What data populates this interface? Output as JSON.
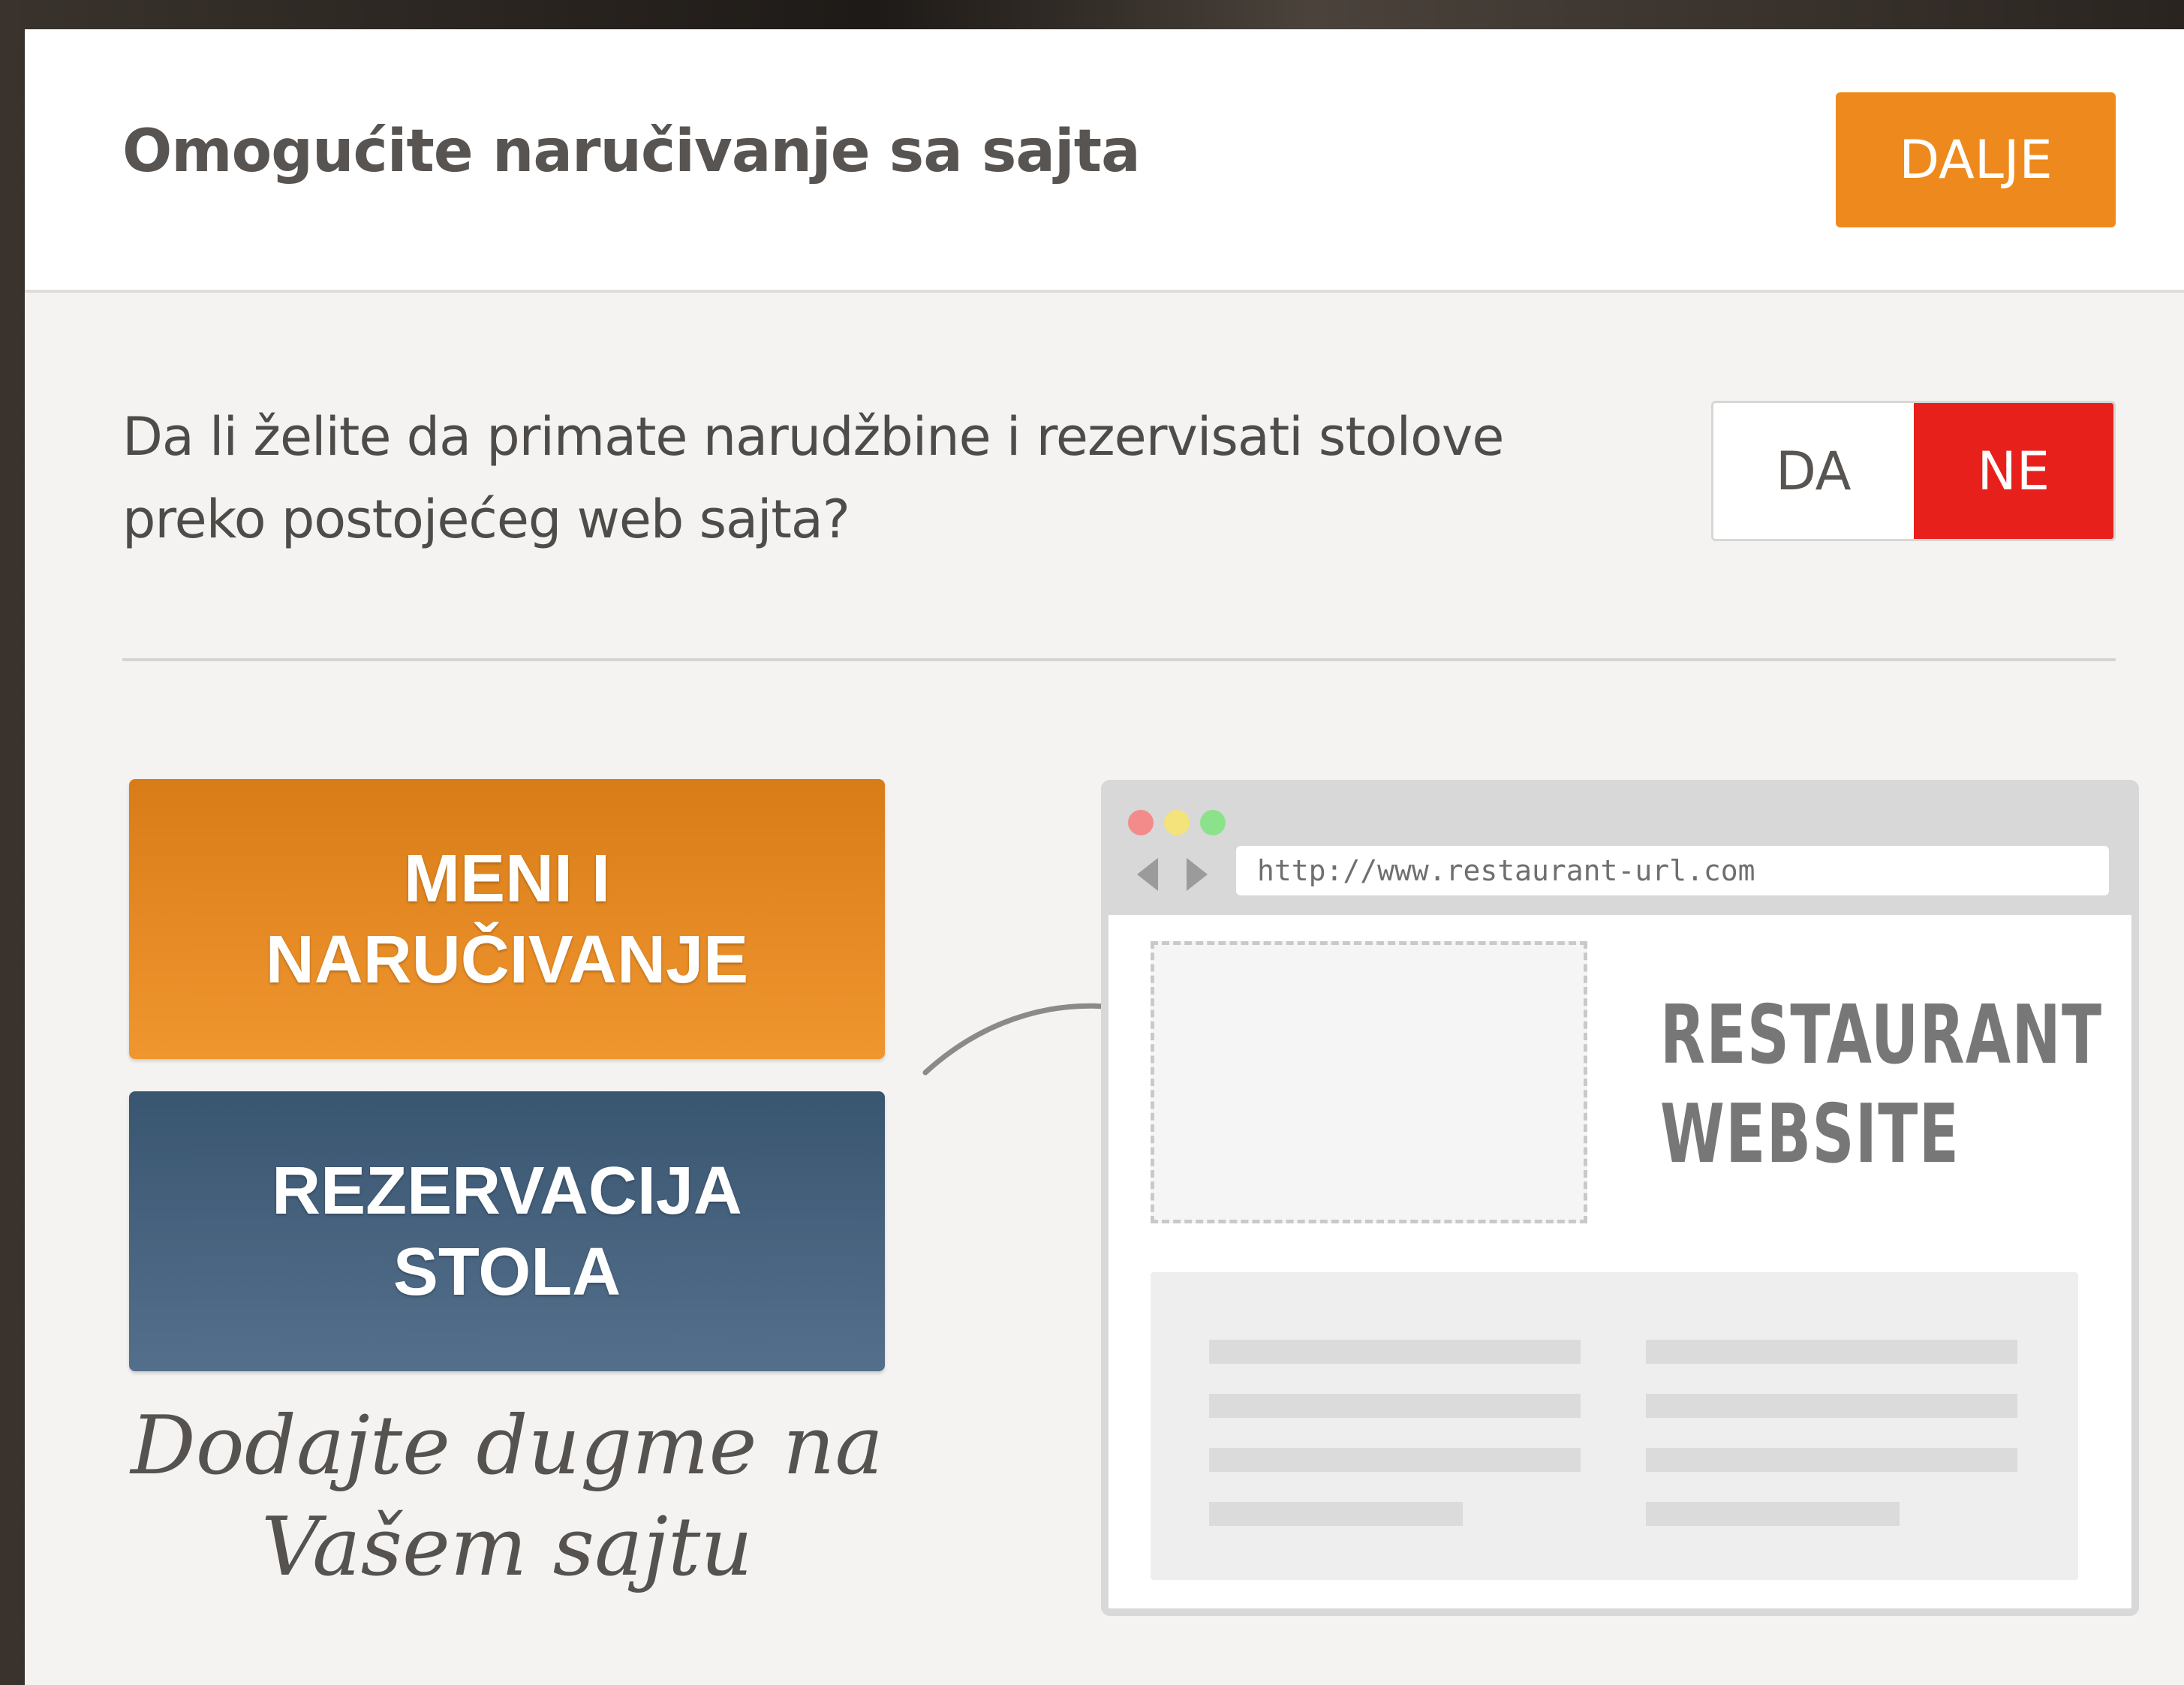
{
  "modal": {
    "title": "Omogućite naručivanje sa sajta",
    "next_button": "DALJE"
  },
  "question": {
    "text": "Da li želite da primate narudžbine i rezervisati stolove preko postojećeg web sajta?"
  },
  "toggle": {
    "yes_label": "DA",
    "no_label": "NE",
    "selected": "NE"
  },
  "illustration": {
    "order_button": "MENI I NARUČIVANJE",
    "reserve_button": "REZERVACIJA STOLA",
    "caption": "Dodajte dugme na Vašem sajtu",
    "browser_url": "http://www.restaurant-url.com",
    "site_title": "RESTAURANT\nWEBSITE"
  },
  "colors": {
    "accent_orange": "#ee8a1d",
    "no_red": "#e8201c",
    "reserve_blue": "#3f5c78"
  }
}
